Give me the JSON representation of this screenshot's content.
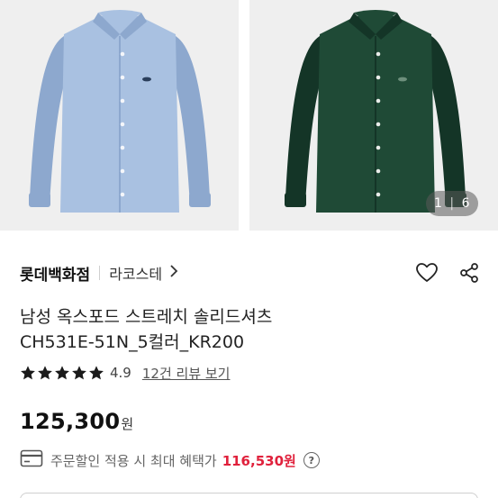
{
  "gallery": {
    "current": "1",
    "total": "6",
    "images": [
      {
        "color": "#a9c1e1",
        "shadow": "#8da8ce",
        "button": "#f4f6fa",
        "logo": "#2b3f5c"
      },
      {
        "color": "#1f4a36",
        "shadow": "#143527",
        "button": "#e9ece9",
        "logo": "#6d8f7c"
      }
    ]
  },
  "store": {
    "name": "롯데백화점",
    "brand": "라코스테",
    "chevron_icon": "chevron-right-icon"
  },
  "actions": {
    "like_icon": "heart-icon",
    "share_icon": "share-icon"
  },
  "product": {
    "title_line1": "남성 옥스포드 스트레치 솔리드셔츠",
    "title_line2": "CH531E-51N_5컬러_KR200"
  },
  "rating": {
    "stars": 5,
    "score": "4.9",
    "review_link": "12건 리뷰 보기"
  },
  "price": {
    "amount": "125,300",
    "unit": "원"
  },
  "benefit": {
    "card_icon": "credit-card-icon",
    "label": "주문할인 적용 시 최대 혜택가",
    "amount": "116,530원",
    "help_icon": "question-icon"
  },
  "colors": {
    "accent_red": "#e0213c",
    "star": "#1a1a1a"
  }
}
